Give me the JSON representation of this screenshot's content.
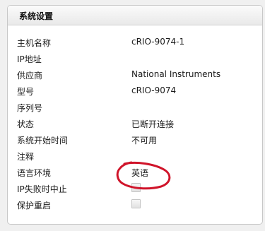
{
  "panel": {
    "title": "系统设置"
  },
  "rows": [
    {
      "label": "主机名称",
      "value": "cRIO-9074-1"
    },
    {
      "label": "IP地址",
      "value": ""
    },
    {
      "label": "供应商",
      "value": "National Instruments"
    },
    {
      "label": "型号",
      "value": "cRIO-9074"
    },
    {
      "label": "序列号",
      "value": ""
    },
    {
      "label": "状态",
      "value": "已断开连接"
    },
    {
      "label": "系统开始时间",
      "value": "不可用"
    },
    {
      "label": "注释",
      "value": ""
    },
    {
      "label": "语言环境",
      "value": "英语"
    },
    {
      "label": "IP失败时中止",
      "checked": false
    },
    {
      "label": "保护重启",
      "checked": false
    }
  ],
  "colors": {
    "annotation": "#d0142a",
    "panel_border": "#c8c8c8"
  }
}
